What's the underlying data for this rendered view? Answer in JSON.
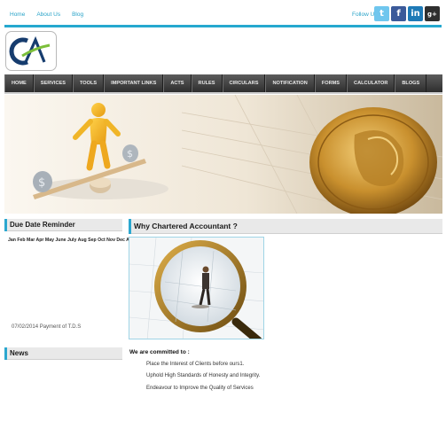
{
  "topbar": {
    "links": [
      "Home",
      "About Us",
      "Blog"
    ],
    "follow_label": "Follow Us",
    "social": [
      {
        "name": "twitter",
        "glyph": "t"
      },
      {
        "name": "facebook",
        "glyph": "f"
      },
      {
        "name": "linkedin",
        "glyph": "in"
      },
      {
        "name": "google-plus",
        "glyph": "g+"
      }
    ]
  },
  "logo": {
    "text": "CA"
  },
  "nav": [
    "HOME",
    "SERVICES",
    "TOOLS",
    "IMPORTANT LINKS",
    "ACTS",
    "RULES",
    "CIRCULARS",
    "NOTIFICATION",
    "FORMS",
    "CALCULATOR",
    "BLOGS"
  ],
  "sidebar": {
    "due_date_title": "Due Date Reminder",
    "months": "Jan Feb Mar Apr May June July Aug Sep Oct Nov Dec All",
    "payment": "07/02/2014 Payment of T.D.S",
    "news_title": "News"
  },
  "main": {
    "why_title": "Why Chartered Accountant ?",
    "committed_title": "We are committed to :",
    "commitments": [
      "Place the Interest of Clients before ours1.",
      "Uphold High Standards of Honesty and Integrity.",
      "Endeavour to Improve the Quality of Services"
    ]
  },
  "colors": {
    "accent": "#25a8cf",
    "nav_bg": "#3d3d3d"
  }
}
